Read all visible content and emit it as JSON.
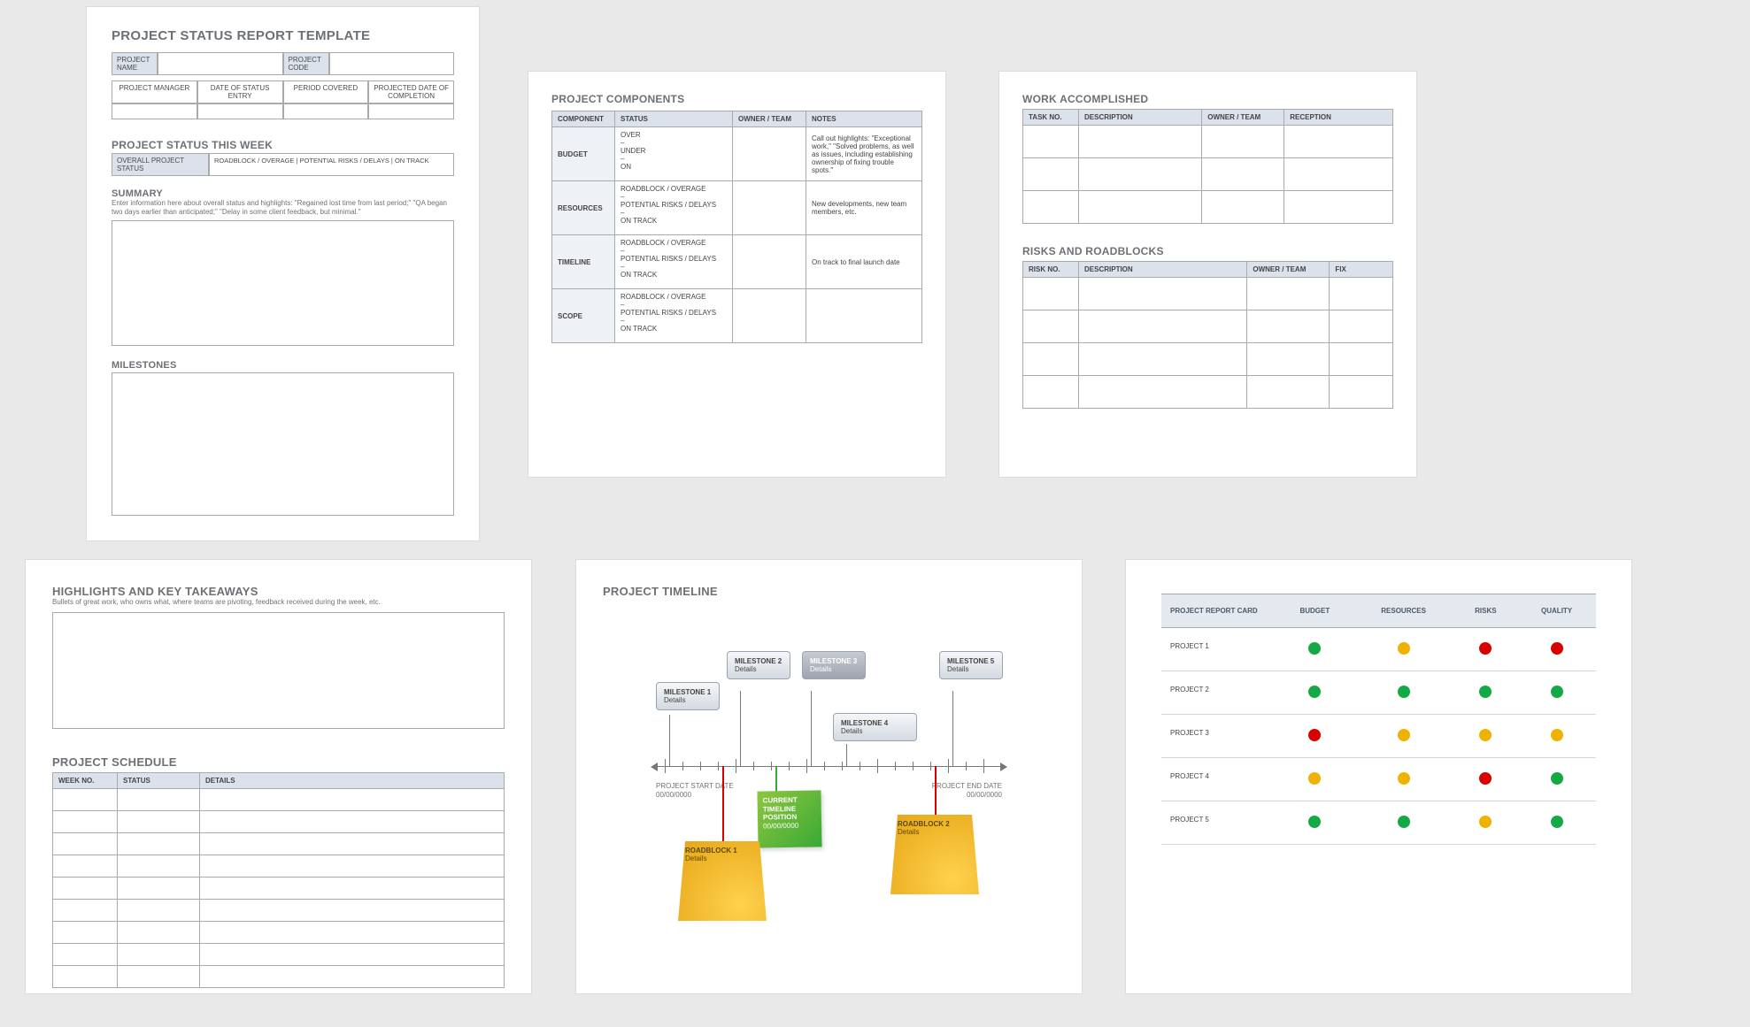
{
  "page1": {
    "title": "PROJECT STATUS REPORT TEMPLATE",
    "projectName": "PROJECT NAME",
    "projectCode": "PROJECT CODE",
    "meta": [
      "PROJECT MANAGER",
      "DATE OF STATUS ENTRY",
      "PERIOD COVERED",
      "PROJECTED DATE OF COMPLETION"
    ],
    "statusWeekTitle": "PROJECT STATUS THIS WEEK",
    "statusLabel": "OVERALL PROJECT STATUS",
    "legend": "ROADBLOCK / OVERAGE    |    POTENTIAL RISKS / DELAYS    |    ON TRACK",
    "summaryTitle": "SUMMARY",
    "summaryHint": "Enter information here about overall status and highlights: \"Regained lost time from last period;\" \"QA began two days earlier than anticipated;\" \"Delay in some client feedback, but minimal.\"",
    "milestonesTitle": "MILESTONES"
  },
  "page2": {
    "title": "PROJECT COMPONENTS",
    "headers": [
      "COMPONENT",
      "STATUS",
      "OWNER / TEAM",
      "NOTES"
    ],
    "rows": [
      {
        "c": "BUDGET",
        "s": "OVER\n–\nUNDER\n–\nON",
        "n": "Call out highlights: \"Exceptional work,\" \"Solved problems, as well as issues, including establishing ownership of fixing trouble spots.\""
      },
      {
        "c": "RESOURCES",
        "s": "ROADBLOCK / OVERAGE\n–\nPOTENTIAL RISKS / DELAYS\n–\nON TRACK",
        "n": "New developments, new team members, etc."
      },
      {
        "c": "TIMELINE",
        "s": "ROADBLOCK / OVERAGE\n–\nPOTENTIAL RISKS / DELAYS\n–\nON TRACK",
        "n": "On track to final launch date"
      },
      {
        "c": "SCOPE",
        "s": "ROADBLOCK / OVERAGE\n–\nPOTENTIAL RISKS / DELAYS\n–\nON TRACK",
        "n": ""
      }
    ]
  },
  "page3": {
    "title1": "WORK ACCOMPLISHED",
    "headers1": [
      "TASK NO.",
      "DESCRIPTION",
      "OWNER / TEAM",
      "RECEPTION"
    ],
    "title2": "RISKS AND ROADBLOCKS",
    "headers2": [
      "RISK NO.",
      "DESCRIPTION",
      "OWNER / TEAM",
      "FIX"
    ]
  },
  "page4": {
    "title1": "HIGHLIGHTS AND KEY TAKEAWAYS",
    "hint": "Bullets of great work, who owns what, where teams are pivoting, feedback received during the week, etc.",
    "title2": "PROJECT SCHEDULE",
    "headers": [
      "WEEK NO.",
      "STATUS",
      "DETAILS"
    ]
  },
  "page5": {
    "title": "PROJECT TIMELINE",
    "startLabel": "PROJECT START DATE",
    "startDate": "00/00/0000",
    "endLabel": "PROJECT END DATE",
    "endDate": "00/00/0000",
    "miles": [
      {
        "t": "MILESTONE 1",
        "d": "Details"
      },
      {
        "t": "MILESTONE 2",
        "d": "Details"
      },
      {
        "t": "MILESTONE 3",
        "d": "Details"
      },
      {
        "t": "MILESTONE 4",
        "d": "Details"
      },
      {
        "t": "MILESTONE 5",
        "d": "Details"
      }
    ],
    "curLabel": "CURRENT TIMELINE POSITION",
    "curDate": "00/00/0000",
    "rb1": "ROADBLOCK 1",
    "rb2": "ROADBLOCK 2",
    "details": "Details"
  },
  "page6": {
    "title": "PROJECT REPORT CARD",
    "cols": [
      "BUDGET",
      "RESOURCES",
      "RISKS",
      "QUALITY"
    ],
    "rows": [
      {
        "p": "PROJECT 1",
        "v": [
          "g",
          "y",
          "r",
          "r"
        ]
      },
      {
        "p": "PROJECT 2",
        "v": [
          "g",
          "g",
          "g",
          "g"
        ]
      },
      {
        "p": "PROJECT 3",
        "v": [
          "r",
          "y",
          "y",
          "y"
        ]
      },
      {
        "p": "PROJECT 4",
        "v": [
          "y",
          "y",
          "r",
          "g"
        ]
      },
      {
        "p": "PROJECT 5",
        "v": [
          "g",
          "g",
          "y",
          "g"
        ]
      }
    ]
  }
}
